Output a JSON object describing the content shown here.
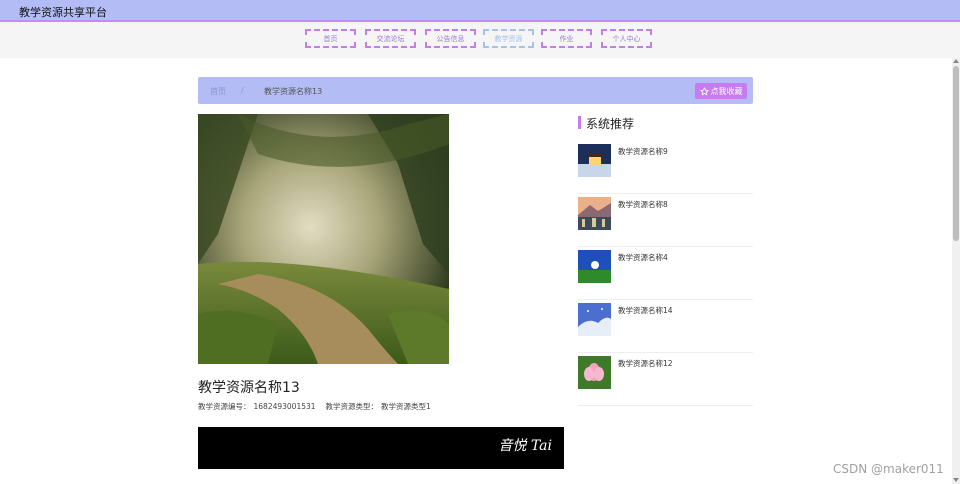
{
  "app": {
    "title": "教学资源共享平台"
  },
  "nav": {
    "items": [
      {
        "label": "首页"
      },
      {
        "label": "交流论坛"
      },
      {
        "label": "公告信息"
      },
      {
        "label": "教学资源"
      },
      {
        "label": "作业"
      },
      {
        "label": "个人中心"
      }
    ],
    "active_index": 3
  },
  "breadcrumb": {
    "home": "首页",
    "separator": "/",
    "current": "教学资源名称13"
  },
  "favorite_button": {
    "icon": "star-outline-icon",
    "label": "点我收藏"
  },
  "resource": {
    "title": "教学资源名称13",
    "code_label": "教学资源编号：",
    "code_value": "1682493001531",
    "type_label": "教学资源类型：",
    "type_value": "教学资源类型1"
  },
  "video": {
    "watermark": "音悦 Tai"
  },
  "recommend": {
    "title": "系统推荐",
    "items": [
      {
        "label": "教学资源名称9",
        "thumb": "night-house-photo"
      },
      {
        "label": "教学资源名称8",
        "thumb": "mountain-city-photo"
      },
      {
        "label": "教学资源名称4",
        "thumb": "blue-sky-field-photo"
      },
      {
        "label": "教学资源名称14",
        "thumb": "anime-sky-photo"
      },
      {
        "label": "教学资源名称12",
        "thumb": "lotus-flower-photo"
      }
    ]
  },
  "watermark": {
    "text": "CSDN @maker011"
  },
  "colors": {
    "header_bg": "#b3bcf5",
    "accent": "#c67cf0",
    "nav_border": "#c37fe6",
    "nav_active": "#a6c2ea"
  }
}
